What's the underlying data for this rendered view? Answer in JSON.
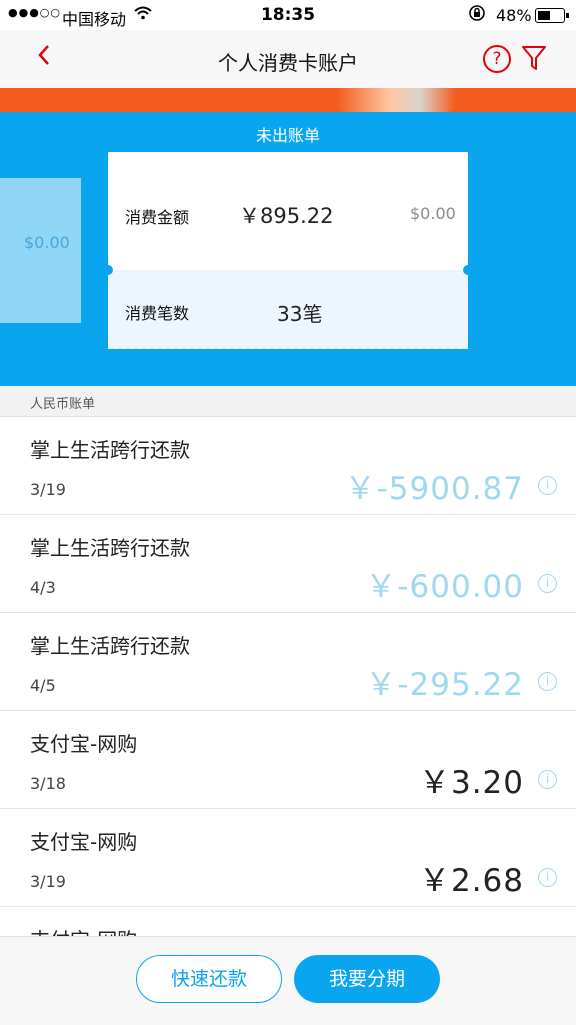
{
  "status_bar": {
    "signal": "●●●○○",
    "carrier": "中国移动",
    "time": "18:35",
    "battery_percent": "48%",
    "battery_level": 0.48
  },
  "nav": {
    "title": "个人消费卡账户",
    "back_icon": "chevron-left-icon",
    "help_icon": "question-icon",
    "filter_icon": "filter-icon",
    "help_glyph": "?"
  },
  "summary": {
    "heading": "未出账单",
    "side_amount": "$0.00",
    "amount_label": "消费金额",
    "amount_value": "￥895.22",
    "amount_secondary": "$0.00",
    "count_label": "消费笔数",
    "count_value": "33笔"
  },
  "section": {
    "title": "人民币账单"
  },
  "transactions": [
    {
      "desc": "掌上生活跨行还款",
      "date": "3/19",
      "amount": "￥-5900.87",
      "negative": true
    },
    {
      "desc": "掌上生活跨行还款",
      "date": "4/3",
      "amount": "￥-600.00",
      "negative": true
    },
    {
      "desc": "掌上生活跨行还款",
      "date": "4/5",
      "amount": "￥-295.22",
      "negative": true
    },
    {
      "desc": "支付宝-网购",
      "date": "3/18",
      "amount": "￥3.20",
      "negative": false
    },
    {
      "desc": "支付宝-网购",
      "date": "3/19",
      "amount": "￥2.68",
      "negative": false
    },
    {
      "desc": "支付宝-网购",
      "date": "",
      "amount": "",
      "negative": false
    }
  ],
  "info_glyph": "i",
  "actions": {
    "quick_repay": "快速还款",
    "installment": "我要分期"
  },
  "colors": {
    "brand_blue": "#0aa5ef",
    "accent_red": "#e60012",
    "negative_amount": "#9fd8ef",
    "banner_orange": "#f25b1d"
  }
}
